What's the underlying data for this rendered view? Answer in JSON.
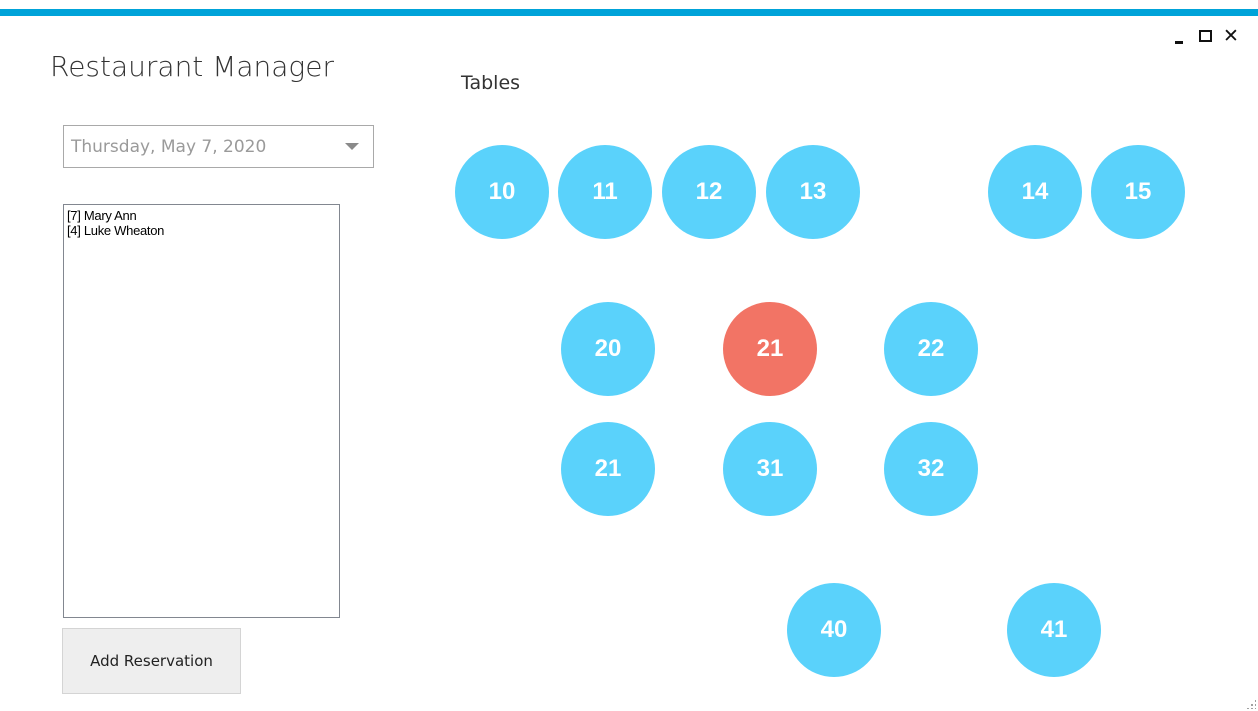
{
  "window": {
    "title": "Restaurant Manager",
    "controls": {
      "minimize": "minimize-icon",
      "maximize": "maximize-icon",
      "close": "✕"
    }
  },
  "colors": {
    "accent_bar": "#00a3d9",
    "table_available": "#5ad2fb",
    "table_occupied": "#f27465"
  },
  "date_picker": {
    "value": "Thursday, May 7, 2020",
    "icon": "chevron-down-icon"
  },
  "reservations": [
    "[7] Mary Ann",
    "[4] Luke Wheaton"
  ],
  "add_button": {
    "label": "Add Reservation"
  },
  "tables_section": {
    "heading": "Tables",
    "tables": [
      {
        "number": "10",
        "status": "available"
      },
      {
        "number": "11",
        "status": "available"
      },
      {
        "number": "12",
        "status": "available"
      },
      {
        "number": "13",
        "status": "available"
      },
      {
        "number": "14",
        "status": "available"
      },
      {
        "number": "15",
        "status": "available"
      },
      {
        "number": "20",
        "status": "available"
      },
      {
        "number": "21",
        "status": "occupied"
      },
      {
        "number": "22",
        "status": "available"
      },
      {
        "number": "21",
        "status": "available"
      },
      {
        "number": "31",
        "status": "available"
      },
      {
        "number": "32",
        "status": "available"
      },
      {
        "number": "40",
        "status": "available"
      },
      {
        "number": "41",
        "status": "available"
      }
    ]
  }
}
